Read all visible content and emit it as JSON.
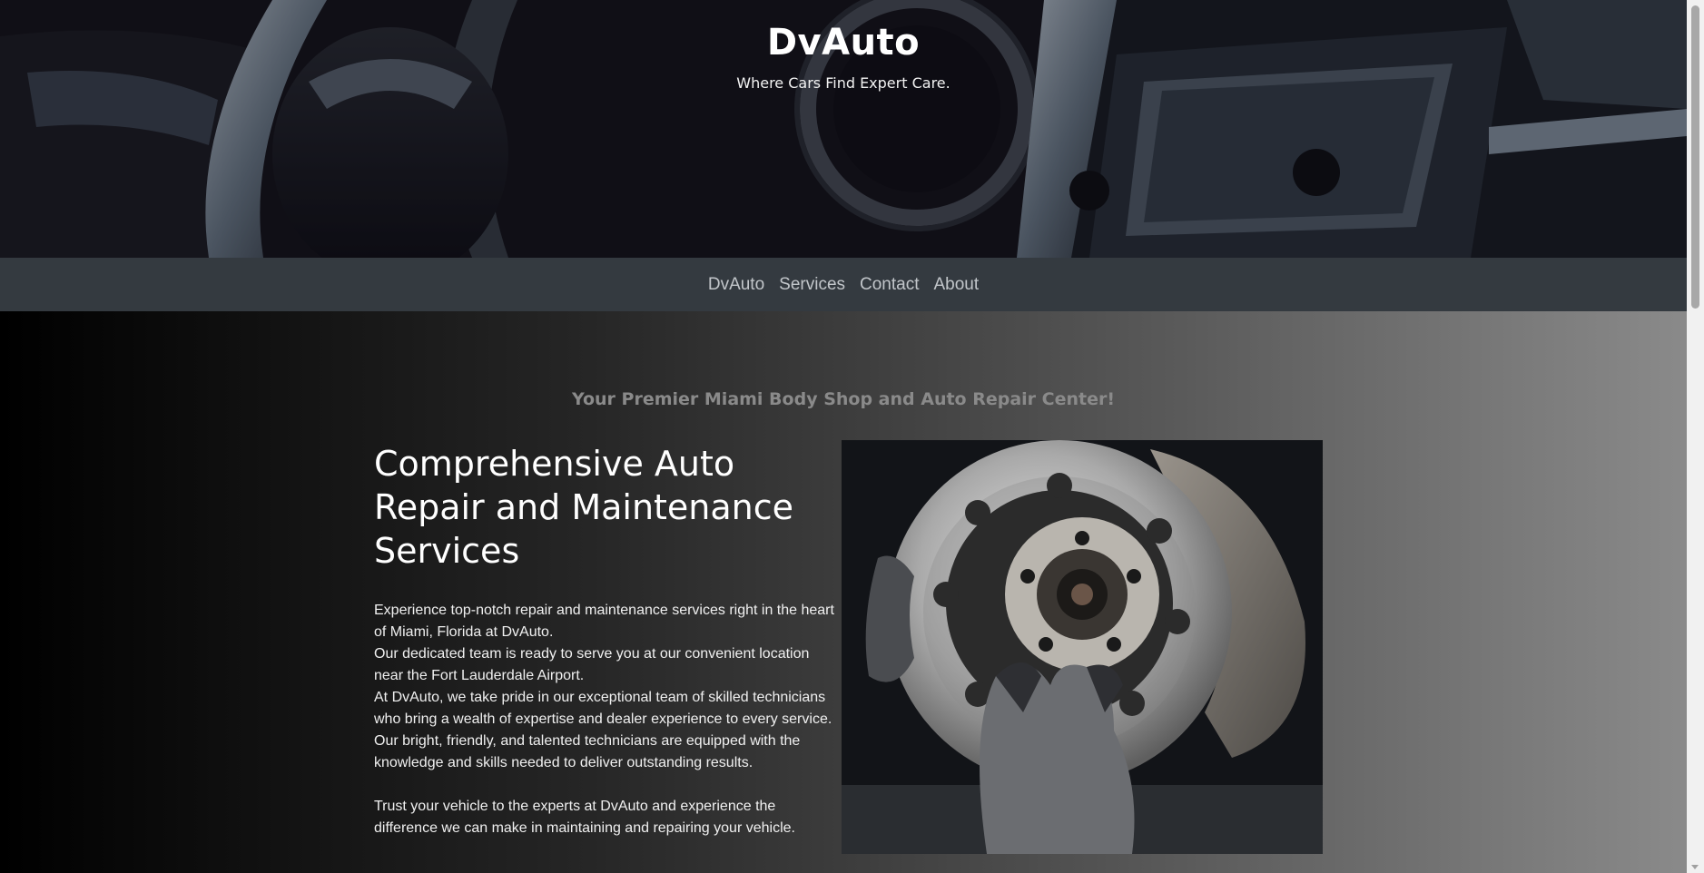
{
  "hero": {
    "title": "DvAuto",
    "tagline": "Where Cars Find Expert Care."
  },
  "nav": {
    "items": [
      {
        "label": "DvAuto"
      },
      {
        "label": "Services"
      },
      {
        "label": "Contact"
      },
      {
        "label": "About"
      }
    ]
  },
  "main": {
    "subtitle": "Your Premier Miami Body Shop and Auto Repair Center!",
    "heading": "Comprehensive Auto Repair and Maintenance Services",
    "paragraphs": [
      "Experience top-notch repair and maintenance services right in the heart of Miami, Florida at DvAuto.",
      "Our dedicated team is ready to serve you at our convenient location near the Fort Lauderdale Airport.",
      "At DvAuto, we take pride in our exceptional team of skilled technicians who bring a wealth of expertise and dealer experience to every service. Our bright, friendly, and talented technicians are equipped with the knowledge and skills needed to deliver outstanding results.",
      "Trust your vehicle to the experts at DvAuto and experience the difference we can make in maintaining and repairing your vehicle."
    ]
  },
  "colors": {
    "nav_bg": "#343a40",
    "nav_link": "#c2c6ca",
    "subtitle": "#8a8a8a"
  }
}
